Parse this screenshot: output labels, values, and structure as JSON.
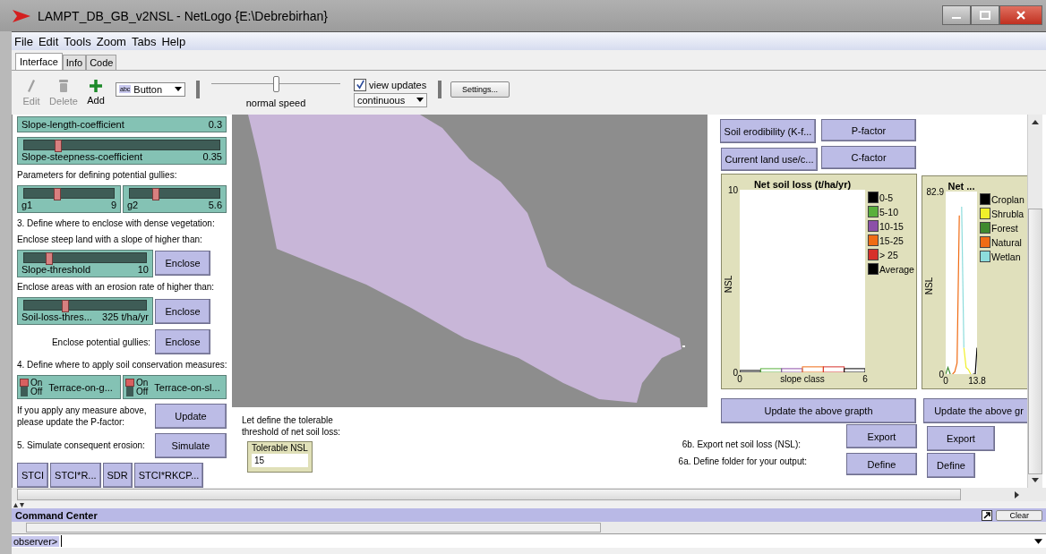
{
  "window": {
    "title": "LAMPT_DB_GB_v2NSL - NetLogo {E:\\Debrebirhan}"
  },
  "menu": [
    "File",
    "Edit",
    "Tools",
    "Zoom",
    "Tabs",
    "Help"
  ],
  "tabs": [
    {
      "label": "Interface",
      "selected": true
    },
    {
      "label": "Info",
      "selected": false
    },
    {
      "label": "Code",
      "selected": false
    }
  ],
  "toolbar": {
    "tools": [
      {
        "label": "Edit",
        "disabled": true
      },
      {
        "label": "Delete",
        "disabled": true
      },
      {
        "label": "Add",
        "disabled": false
      }
    ],
    "widget_type": {
      "icon_text": "abc",
      "label": "Button"
    },
    "speed": {
      "label": "normal speed",
      "level": 0.5
    },
    "view_updates": {
      "label": "view updates",
      "checked": true
    },
    "update_mode": "continuous",
    "settings": "Settings..."
  },
  "left_panel": [
    {
      "widgets": [
        {
          "kind": "slider",
          "label": "Slope-length-coefficient",
          "value": "0.3"
        }
      ]
    },
    {
      "widgets": [
        {
          "kind": "slider",
          "label": "Slope-steepness-coefficient",
          "value": "0.35",
          "level": 0.17
        }
      ]
    },
    {
      "widgets": [
        {
          "kind": "note",
          "text": "Parameters for defining potential gullies:"
        }
      ]
    },
    {
      "widgets": [
        {
          "kind": "slider",
          "label": "g1",
          "value": "9",
          "level": 0.36
        },
        {
          "kind": "slider",
          "label": "g2",
          "value": "5.6",
          "level": 0.28
        }
      ]
    },
    {
      "widgets": [
        {
          "kind": "note",
          "text": "3. Define where to enclose with dense vegetation:"
        }
      ]
    },
    {
      "widgets": [
        {
          "kind": "note",
          "text": "Enclose steep land with a slope of higher than:"
        }
      ]
    },
    {
      "widgets": [
        {
          "kind": "slider",
          "label": "Slope-threshold",
          "value": "10",
          "level": 0.2
        },
        {
          "kind": "button",
          "label": "Enclose"
        }
      ]
    },
    {
      "widgets": [
        {
          "kind": "note",
          "text": "Enclose areas with an erosion rate of higher than:"
        }
      ]
    },
    {
      "widgets": [
        {
          "kind": "slider",
          "label": "Soil-loss-thres...",
          "value": "325 t/ha/yr",
          "level": 0.33
        },
        {
          "kind": "button",
          "label": "Enclose"
        }
      ]
    },
    {
      "widgets": [
        {
          "kind": "caption",
          "text": "Enclose potential gullies:"
        },
        {
          "kind": "button",
          "label": "Enclose"
        }
      ]
    },
    {
      "widgets": [
        {
          "kind": "note",
          "text": "4. Define where to apply soil conservation measures:"
        }
      ]
    },
    {
      "widgets": [
        {
          "kind": "switch",
          "label": "Terrace-on-g...",
          "on": true,
          "on_text": "On",
          "off_text": "Off"
        },
        {
          "kind": "switch",
          "label": "Terrace-on-sl...",
          "on": true,
          "on_text": "On",
          "off_text": "Off"
        }
      ]
    },
    {
      "widgets": [
        {
          "kind": "note",
          "text": "If you apply any measure above,\nplease update the P-factor:"
        },
        {
          "kind": "button",
          "label": "Update"
        }
      ]
    },
    {
      "widgets": [
        {
          "kind": "note",
          "text": "5. Simulate consequent erosion:"
        },
        {
          "kind": "button",
          "label": "Simulate"
        }
      ]
    },
    {
      "widgets": [
        {
          "kind": "button",
          "label": "STCI"
        },
        {
          "kind": "button",
          "label": "STCI*R..."
        },
        {
          "kind": "button",
          "label": "SDR"
        },
        {
          "kind": "button",
          "label": "STCI*RKCP..."
        }
      ]
    }
  ],
  "tolerance": {
    "note": "Let define the tolerable\nthreshold of net soil loss:",
    "input": {
      "label": "Tolerable NSL",
      "value": "15"
    }
  },
  "factor_buttons": [
    "Soil erodibility (K-f...",
    "P-factor",
    "Current land use/c...",
    "C-factor"
  ],
  "plots": [
    {
      "chart_data": {
        "type": "bar",
        "title": "Net soil loss (t/ha/yr)",
        "xlabel": "slope class",
        "ylabel": "NSL",
        "x": [
          0,
          1,
          2,
          3,
          4,
          5
        ],
        "xlim": [
          0,
          6
        ],
        "ylim": [
          0,
          10
        ],
        "xticks": [
          {
            "value": 0,
            "label": "0"
          },
          {
            "value": 6,
            "label": "6"
          }
        ],
        "yticks": [
          {
            "value": 0,
            "label": "0"
          },
          {
            "value": 10,
            "label": "10"
          }
        ],
        "legend": "right",
        "series": [
          {
            "name": "0-5",
            "color": "#000000",
            "values": [
              0.1,
              null,
              null,
              null,
              null,
              null
            ]
          },
          {
            "name": "5-10",
            "color": "#59b03c",
            "values": [
              null,
              0.2,
              null,
              null,
              null,
              null
            ]
          },
          {
            "name": "10-15",
            "color": "#8c50a8",
            "values": [
              null,
              null,
              0.2,
              null,
              null,
              null
            ]
          },
          {
            "name": "15-25",
            "color": "#f06c14",
            "values": [
              null,
              null,
              null,
              0.3,
              null,
              null
            ]
          },
          {
            "name": "> 25",
            "color": "#d7302a",
            "values": [
              null,
              null,
              null,
              null,
              0.3,
              null
            ]
          },
          {
            "name": "Average",
            "color": "#000000",
            "values": [
              null,
              null,
              null,
              null,
              null,
              0.2
            ]
          }
        ]
      }
    },
    {
      "chart_data": {
        "type": "line",
        "title": "Net ...",
        "ylabel": "NSL",
        "x": [
          0,
          1,
          2,
          3,
          4,
          5,
          6,
          7,
          8,
          9,
          10,
          11,
          12,
          13,
          13.8
        ],
        "xlim": [
          0,
          13.8
        ],
        "ylim": [
          0,
          82.9
        ],
        "xticks": [
          {
            "value": 0,
            "label": "0"
          },
          {
            "value": 13.8,
            "label": "13.8"
          }
        ],
        "yticks": [
          {
            "value": 0,
            "label": "0"
          },
          {
            "value": 82.9,
            "label": "82.9"
          }
        ],
        "legend": "right",
        "series": [
          {
            "name": "Croplan",
            "color": "#000000",
            "values": [
              null,
              null,
              null,
              null,
              null,
              null,
              null,
              null,
              null,
              null,
              null,
              null,
              0,
              0,
              12
            ]
          },
          {
            "name": "Shrubla",
            "color": "#f0f02a",
            "values": [
              null,
              null,
              null,
              null,
              null,
              null,
              null,
              null,
              12,
              3,
              2,
              0,
              null,
              null,
              null
            ]
          },
          {
            "name": "Forest",
            "color": "#3e8a2e",
            "values": [
              0,
              3,
              0,
              null,
              null,
              null,
              null,
              null,
              null,
              null,
              null,
              null,
              null,
              null,
              null
            ]
          },
          {
            "name": "Natural",
            "color": "#f06c14",
            "values": [
              null,
              null,
              null,
              0,
              1,
              5,
              72,
              null,
              null,
              null,
              null,
              null,
              null,
              null,
              null
            ]
          },
          {
            "name": "Wetlan",
            "color": "#8ddcdc",
            "values": [
              null,
              null,
              null,
              null,
              null,
              null,
              null,
              76,
              12,
              null,
              null,
              null,
              null,
              null,
              null
            ]
          }
        ]
      }
    }
  ],
  "update_buttons": [
    "Update the above grapth",
    "Update the above gr"
  ],
  "export_notes": [
    "6b. Export net soil loss (NSL):",
    "6a. Define folder for your output:"
  ],
  "export_buttons": [
    "Export",
    "Export"
  ],
  "define_buttons": [
    "Define",
    "Define"
  ],
  "command_center": {
    "title": "Command Center",
    "clear": "Clear",
    "prompt": "observer>"
  }
}
